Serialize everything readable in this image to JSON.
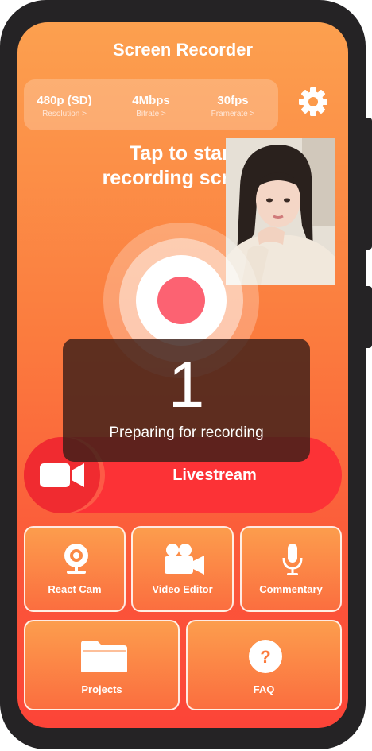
{
  "app": {
    "title": "Screen Recorder"
  },
  "settings": [
    {
      "value": "480p (SD)",
      "label": "Resolution >"
    },
    {
      "value": "4Mbps",
      "label": "Bitrate >"
    },
    {
      "value": "30fps",
      "label": "Framerate >"
    }
  ],
  "hero": {
    "line1": "Tap to start",
    "line2": "recording screen"
  },
  "countdown": {
    "number": "1",
    "message": "Preparing for recording"
  },
  "livestream": {
    "label": "Livestream"
  },
  "tiles": {
    "react_cam": "React Cam",
    "video_editor": "Video Editor",
    "commentary": "Commentary",
    "projects": "Projects",
    "faq": "FAQ"
  },
  "colors": {
    "accent_start": "#fca04f",
    "accent_end": "#fc4438",
    "record": "#fc6272",
    "live": "#fc3236"
  }
}
